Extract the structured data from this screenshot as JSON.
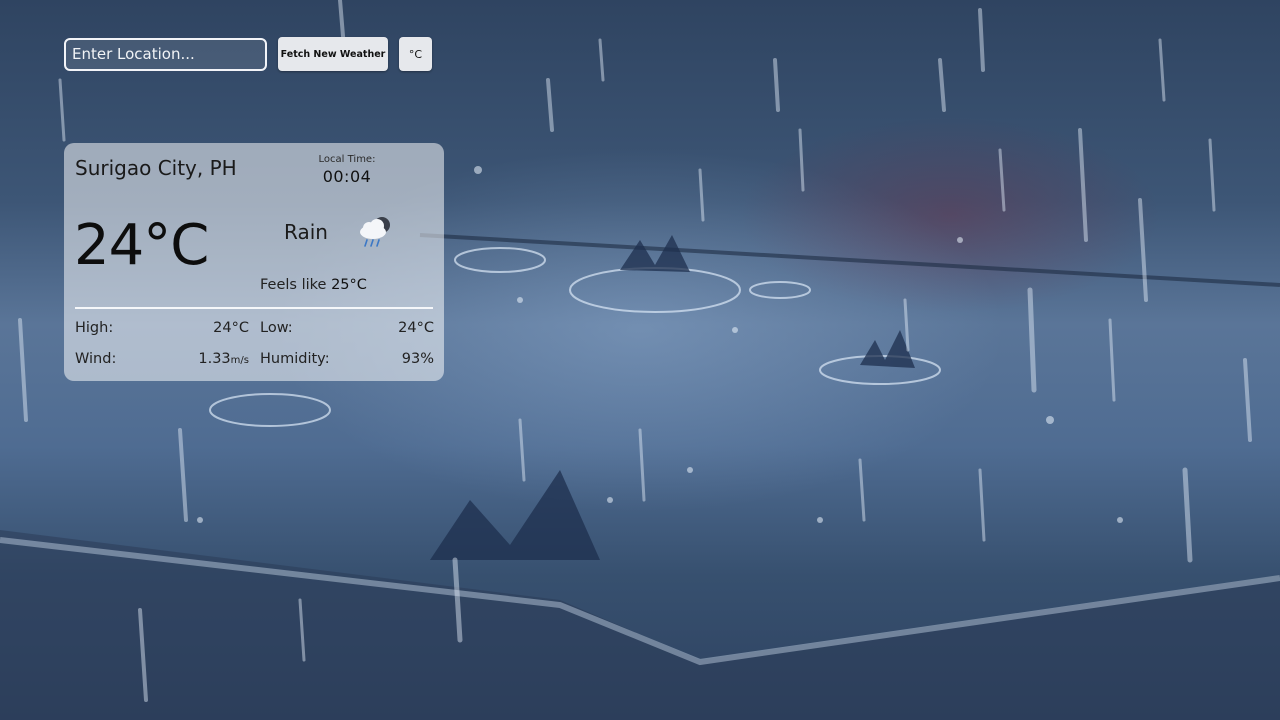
{
  "controls": {
    "location_placeholder": "Enter Location...",
    "fetch_label": "Fetch New Weather",
    "unit_label": "°C"
  },
  "weather": {
    "city": "Surigao City, PH",
    "local_time_label": "Local Time:",
    "local_time": "00:04",
    "temperature": "24°C",
    "condition": "Rain",
    "condition_icon": "cloud-rain-icon",
    "feels_like_label": "Feels like",
    "feels_like_value": "25°C",
    "high_label": "High:",
    "high_value": "24°C",
    "low_label": "Low:",
    "low_value": "24°C",
    "wind_label": "Wind:",
    "wind_value": "1.33",
    "wind_unit": "m/s",
    "humidity_label": "Humidity:",
    "humidity_value": "93%"
  },
  "colors": {
    "card_background": "#ffffff",
    "button_background": "#e6e8ec",
    "text_primary": "#111111"
  }
}
